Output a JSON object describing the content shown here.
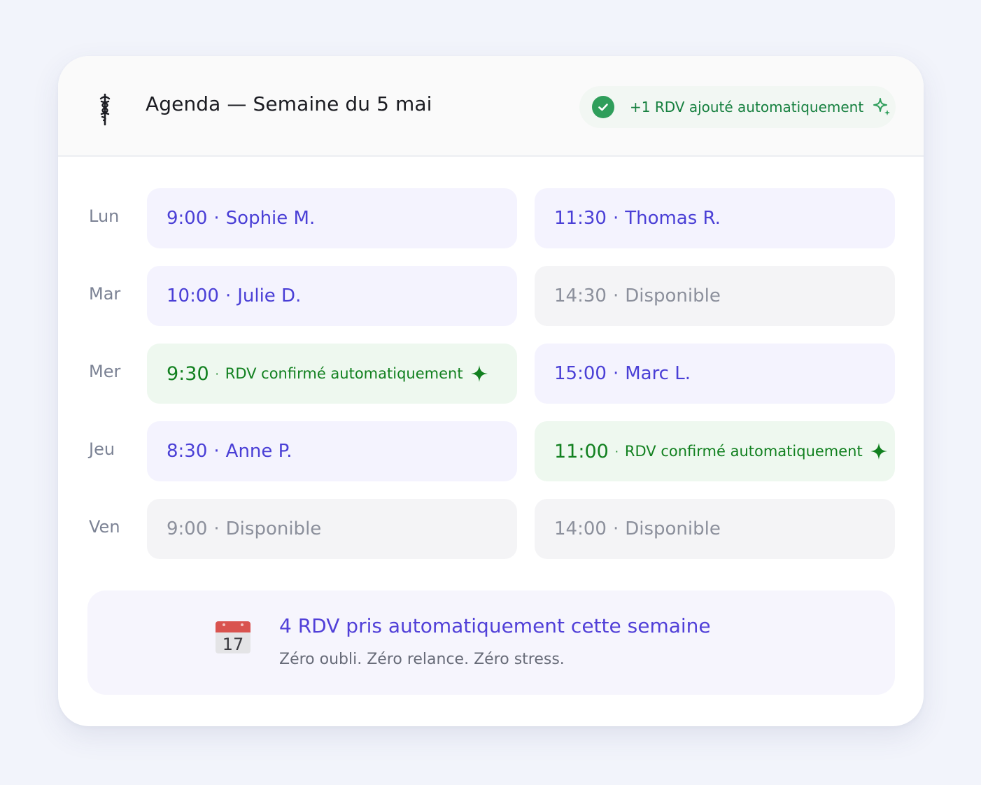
{
  "header": {
    "title": "Agenda — Semaine du 5 mai",
    "logo_icon": "caduceus-icon",
    "notification": {
      "icon": "check-circle-icon",
      "text": "+1 RDV ajouté automatiquement",
      "trail_icon": "sparkle-icon"
    }
  },
  "days": [
    {
      "label": "Lun",
      "slots": [
        {
          "time": "9:00",
          "text": "Sophie M.",
          "status": "booked"
        },
        {
          "time": "11:30",
          "text": "Thomas R.",
          "status": "booked"
        }
      ]
    },
    {
      "label": "Mar",
      "slots": [
        {
          "time": "10:00",
          "text": "Julie D.",
          "status": "booked"
        },
        {
          "time": "14:30",
          "text": "Disponible",
          "status": "free"
        }
      ]
    },
    {
      "label": "Mer",
      "slots": [
        {
          "time": "9:30",
          "text": "RDV confirmé automatiquement",
          "status": "auto"
        },
        {
          "time": "15:00",
          "text": "Marc L.",
          "status": "booked"
        }
      ]
    },
    {
      "label": "Jeu",
      "slots": [
        {
          "time": "8:30",
          "text": "Anne P.",
          "status": "booked"
        },
        {
          "time": "11:00",
          "text": "RDV confirmé automatiquement",
          "status": "auto"
        }
      ]
    },
    {
      "label": "Ven",
      "slots": [
        {
          "time": "9:00",
          "text": "Disponible",
          "status": "free"
        },
        {
          "time": "14:00",
          "text": "Disponible",
          "status": "free"
        }
      ]
    }
  ],
  "summary": {
    "icon": "calendar-icon",
    "calendar_day": "17",
    "title": "4 RDV pris automatiquement cette semaine",
    "subtitle": "Zéro oubli. Zéro relance. Zéro stress."
  },
  "colors": {
    "booked_text": "#4a3fd6",
    "booked_bg": "#f4f3fe",
    "auto_text": "#11801f",
    "auto_bg": "#eef8ef",
    "free_text": "#8c909c",
    "free_bg": "#f4f4f6"
  }
}
